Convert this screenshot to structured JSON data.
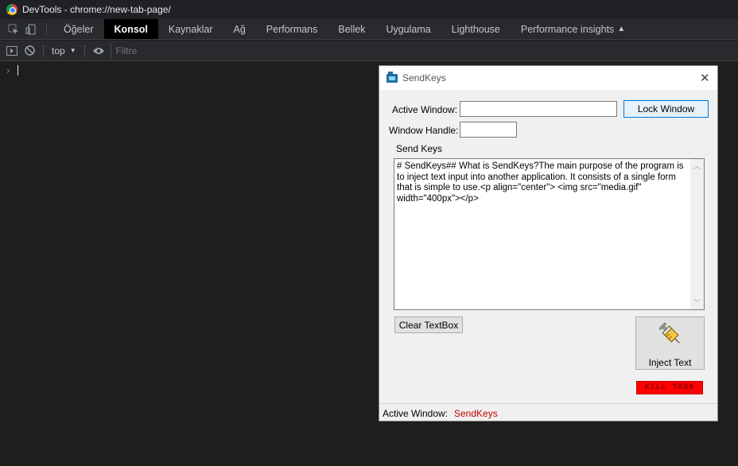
{
  "devtools": {
    "window_title": "DevTools - chrome://new-tab-page/",
    "tabs": [
      {
        "label": "Öğeler"
      },
      {
        "label": "Konsol"
      },
      {
        "label": "Kaynaklar"
      },
      {
        "label": "Ağ"
      },
      {
        "label": "Performans"
      },
      {
        "label": "Bellek"
      },
      {
        "label": "Uygulama"
      },
      {
        "label": "Lighthouse"
      },
      {
        "label": "Performance insights"
      }
    ],
    "active_tab": "Konsol",
    "context": "top",
    "filter_placeholder": "Filtre",
    "prompt_symbol": "›"
  },
  "sendkeys": {
    "title": "SendKeys",
    "close_glyph": "✕",
    "active_window_label": "Active Window:",
    "active_window_value": "",
    "lock_button": "Lock Window",
    "window_handle_label": "Window Handle:",
    "window_handle_value": "",
    "send_keys_label": "Send Keys",
    "textbox_content": "# SendKeys## What is SendKeys?The main purpose of the program is to inject text input into another application. It consists of a single form that is simple to use.<p align=\"center\">  <img src=\"media.gif\" width=\"400px\"></p>",
    "clear_button": "Clear TextBox",
    "inject_button": "Inject Text",
    "kill_button": "KILL TASK",
    "status_label": "Active Window:",
    "status_value": "SendKeys"
  },
  "colors": {
    "devtools_bg": "#1e1f1c",
    "tab_active_bg": "#000000",
    "status_value": "#c40000",
    "kill_bg": "#ff0000"
  }
}
